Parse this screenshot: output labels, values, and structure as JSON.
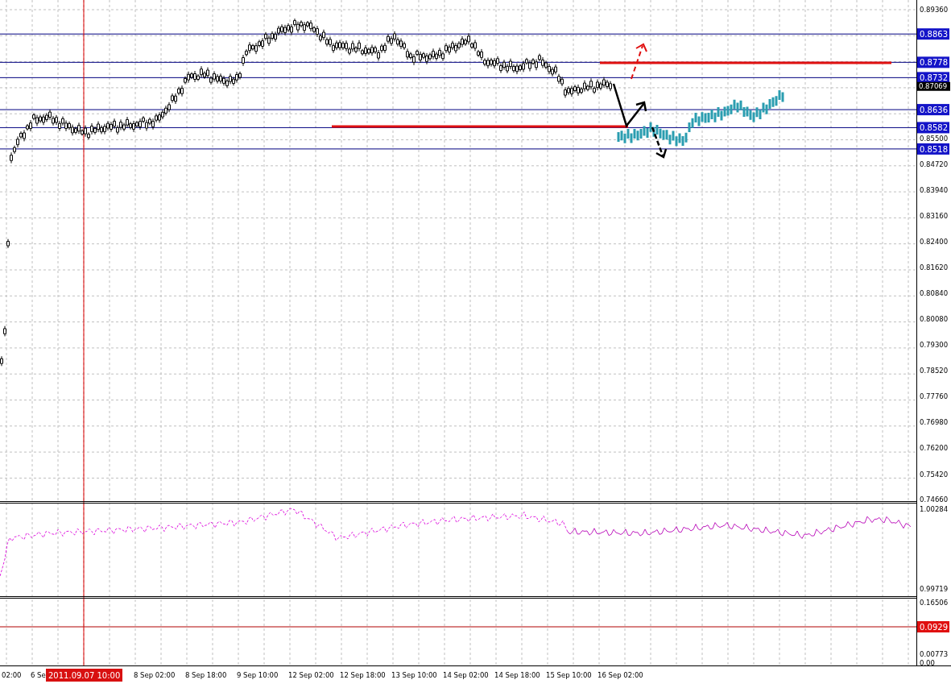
{
  "chart": {
    "price_axis": [
      "0.89360",
      "0.85500",
      "0.84720",
      "0.83940",
      "0.83160",
      "0.82400",
      "0.81620",
      "0.80840",
      "0.80080",
      "0.79300",
      "0.78520",
      "0.77760",
      "0.76980",
      "0.76200",
      "0.75420",
      "0.74660"
    ],
    "levels": [
      {
        "price": "0.8863"
      },
      {
        "price": "0.8778"
      },
      {
        "price": "0.8732"
      },
      {
        "price": "0.8636"
      },
      {
        "price": "0.8582"
      },
      {
        "price": "0.8518"
      }
    ],
    "current_price": "0.87069",
    "cursor": {
      "time": "2011.09.07 10:00"
    },
    "time_axis": [
      "02:00",
      "6 Se",
      "8 Sep 02:00",
      "8 Sep 18:00",
      "9 Sep 10:00",
      "12 Sep 02:00",
      "12 Sep 18:00",
      "13 Sep 10:00",
      "14 Sep 02:00",
      "14 Sep 18:00",
      "15 Sep 10:00",
      "16 Sep 02:00"
    ],
    "indicator_pane": {
      "axis": [
        "1.00284",
        "0.99719"
      ]
    },
    "lower_pane": {
      "axis": [
        "0.16506",
        "0.00773",
        "0.00"
      ],
      "level": "0.0929"
    }
  }
}
